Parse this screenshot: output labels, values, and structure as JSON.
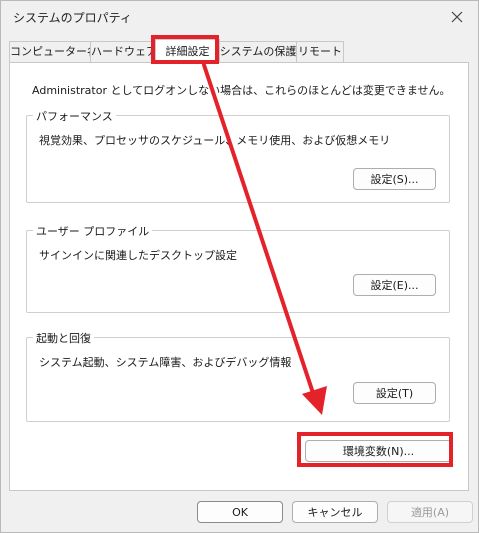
{
  "window": {
    "title": "システムのプロパティ"
  },
  "tabs": [
    {
      "label": "コンピューター名",
      "active": false
    },
    {
      "label": "ハードウェア",
      "active": false
    },
    {
      "label": "詳細設定",
      "active": true
    },
    {
      "label": "システムの保護",
      "active": false
    },
    {
      "label": "リモート",
      "active": false
    }
  ],
  "notice": "Administrator としてログオンしない場合は、これらのほとんどは変更できません。",
  "groups": {
    "performance": {
      "title": "パフォーマンス",
      "description": "視覚効果、プロセッサのスケジュール、メモリ使用、および仮想メモリ",
      "button": "設定(S)..."
    },
    "profile": {
      "title": "ユーザー プロファイル",
      "description": "サインインに関連したデスクトップ設定",
      "button": "設定(E)..."
    },
    "startup": {
      "title": "起動と回復",
      "description": "システム起動、システム障害、およびデバッグ情報",
      "button": "設定(T)"
    }
  },
  "env_button": "環境変数(N)...",
  "footer": {
    "ok": "OK",
    "cancel": "キャンセル",
    "apply": "適用(A)"
  },
  "colors": {
    "highlight": "#e4222a"
  },
  "icons": {
    "close": "close-icon",
    "arrow": "arrow-annotation"
  }
}
